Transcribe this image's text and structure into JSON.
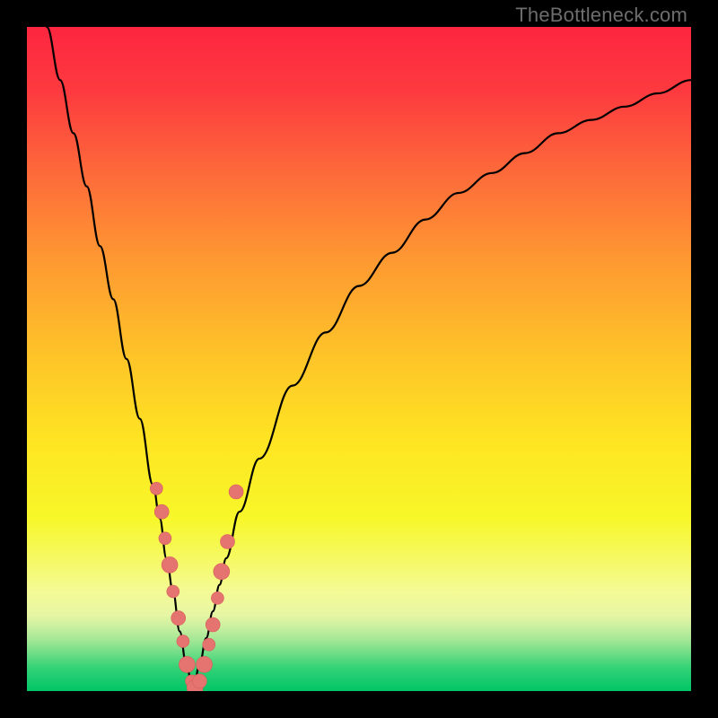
{
  "watermark": "TheBottleneck.com",
  "colors": {
    "frame": "#000000",
    "curve": "#000000",
    "marker_fill": "#e5736f",
    "marker_stroke": "#d75f5b",
    "gradient_stops": [
      {
        "offset": 0.0,
        "color": "#fd2640"
      },
      {
        "offset": 0.1,
        "color": "#fd3b3f"
      },
      {
        "offset": 0.22,
        "color": "#fd6a3a"
      },
      {
        "offset": 0.35,
        "color": "#fe9832"
      },
      {
        "offset": 0.5,
        "color": "#fec528"
      },
      {
        "offset": 0.63,
        "color": "#fee622"
      },
      {
        "offset": 0.74,
        "color": "#f7f72a"
      },
      {
        "offset": 0.8,
        "color": "#f6f962"
      },
      {
        "offset": 0.85,
        "color": "#f4fa95"
      },
      {
        "offset": 0.885,
        "color": "#e7f6a4"
      },
      {
        "offset": 0.905,
        "color": "#c7efa0"
      },
      {
        "offset": 0.925,
        "color": "#9ee694"
      },
      {
        "offset": 0.945,
        "color": "#6adc85"
      },
      {
        "offset": 0.965,
        "color": "#33d276"
      },
      {
        "offset": 1.0,
        "color": "#00c566"
      }
    ]
  },
  "chart_data": {
    "type": "line",
    "title": "",
    "xlabel": "",
    "ylabel": "",
    "xlim": [
      0,
      100
    ],
    "ylim": [
      0,
      100
    ],
    "x_min_point": 25,
    "series": [
      {
        "name": "bottleneck-curve",
        "x": [
          3,
          5,
          7,
          9,
          11,
          13,
          15,
          17,
          19,
          20,
          21,
          22,
          23,
          24,
          25,
          26,
          27,
          28,
          29,
          30,
          32,
          35,
          40,
          45,
          50,
          55,
          60,
          65,
          70,
          75,
          80,
          85,
          90,
          95,
          100
        ],
        "y": [
          100,
          92,
          84,
          76,
          67,
          59,
          50,
          41,
          31,
          26,
          20,
          15,
          9,
          4,
          0,
          4,
          8,
          12,
          16,
          20,
          27,
          35,
          46,
          54,
          61,
          66,
          71,
          75,
          78,
          81,
          84,
          86,
          88,
          90,
          92
        ]
      }
    ],
    "markers": {
      "name": "highlight-points",
      "x": [
        19.5,
        20.3,
        20.8,
        21.5,
        22.0,
        22.8,
        23.5,
        24.1,
        24.8,
        25.3,
        26.0,
        26.7,
        27.4,
        28.0,
        28.7,
        29.3,
        30.2,
        31.5
      ],
      "y": [
        30.5,
        27.0,
        23.0,
        19.0,
        15.0,
        11.0,
        7.5,
        4.0,
        1.5,
        0.5,
        1.5,
        4.0,
        7.0,
        10.0,
        14.0,
        18.0,
        22.5,
        30.0
      ],
      "r": [
        7,
        8,
        7,
        9,
        7,
        8,
        7,
        9,
        7,
        9,
        8,
        9,
        7,
        8,
        7,
        9,
        8,
        8
      ]
    }
  }
}
